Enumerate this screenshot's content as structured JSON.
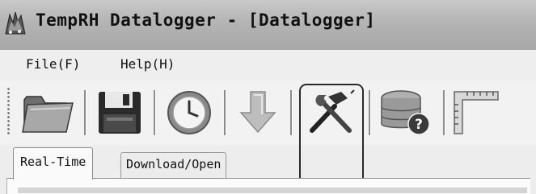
{
  "window": {
    "title": "TempRH Datalogger - [Datalogger]"
  },
  "menu": {
    "file_label": "File(F)",
    "help_label": "Help(H)"
  },
  "toolbar": {
    "buttons": [
      {
        "name": "open-folder",
        "icon": "folder-icon"
      },
      {
        "name": "save",
        "icon": "floppy-disk-icon"
      },
      {
        "name": "clock",
        "icon": "clock-icon"
      },
      {
        "name": "download",
        "icon": "down-arrow-icon"
      },
      {
        "name": "settings-tools",
        "icon": "hammer-wrench-icon"
      },
      {
        "name": "database-help",
        "icon": "database-question-icon"
      },
      {
        "name": "ruler",
        "icon": "ruler-icon"
      }
    ]
  },
  "tabs": {
    "realtime_label": "Real-Time",
    "download_label": "Download/Open"
  },
  "colors": {
    "title_bar": "#b4b4b4",
    "menu_bar": "#eeeeee",
    "toolbar": "#f2f2f2",
    "highlight_border": "#2a2a2a"
  }
}
